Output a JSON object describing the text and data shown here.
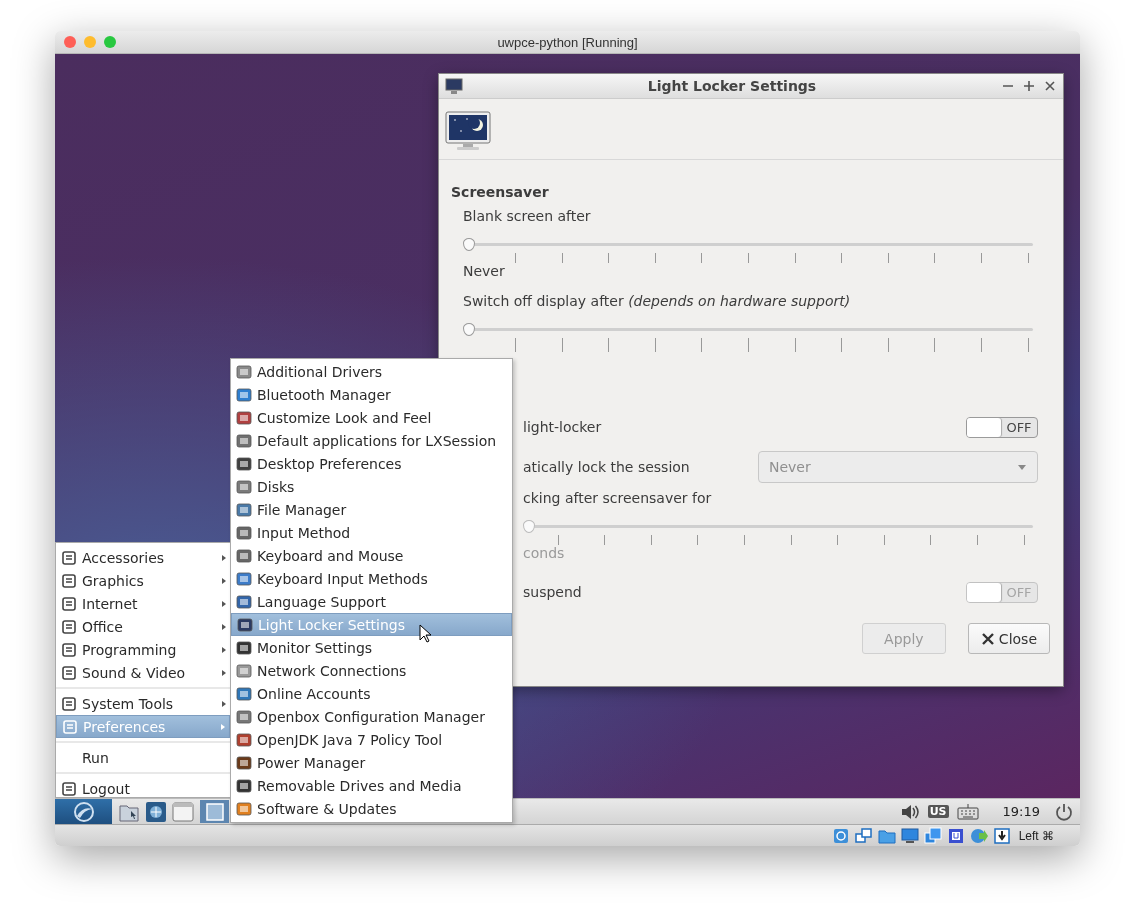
{
  "host_window": {
    "title": "uwpce-python [Running]"
  },
  "dialog": {
    "title": "Light Locker Settings",
    "section": "Screensaver",
    "rows": [
      {
        "kind": "slider",
        "label": "Blank screen after",
        "level": 0,
        "value_label": "Never",
        "disabled": false
      },
      {
        "kind": "slider",
        "label": "Switch off display after *(depends on hardware support)*",
        "level": 0,
        "disabled": false
      }
    ],
    "lock_rows": [
      {
        "kind": "switch",
        "label": "light-locker",
        "on": false,
        "state_text": "OFF",
        "disabled": false
      },
      {
        "kind": "combo",
        "label": "atically lock the session",
        "value": "Never",
        "disabled": true
      },
      {
        "kind": "slider",
        "label": "cking after screensaver for",
        "level": 0,
        "value_label": "conds",
        "disabled": true
      },
      {
        "kind": "switch",
        "label": "suspend",
        "on": false,
        "state_text": "OFF",
        "disabled": true
      }
    ],
    "buttons": [
      {
        "kind": "apply",
        "label": "Apply",
        "disabled": true
      },
      {
        "kind": "close",
        "label": "Close",
        "disabled": false
      }
    ]
  },
  "start_menu": {
    "groups": [
      {
        "items": [
          {
            "label": "Accessories",
            "icon": true,
            "has_submenu": true,
            "selected": false
          },
          {
            "label": "Graphics",
            "icon": true,
            "has_submenu": true,
            "selected": false
          },
          {
            "label": "Internet",
            "icon": true,
            "has_submenu": true,
            "selected": false
          },
          {
            "label": "Office",
            "icon": true,
            "has_submenu": true,
            "selected": false
          },
          {
            "label": "Programming",
            "icon": true,
            "has_submenu": true,
            "selected": false
          },
          {
            "label": "Sound & Video",
            "icon": true,
            "has_submenu": true,
            "selected": false
          }
        ]
      },
      {
        "items": [
          {
            "label": "System Tools",
            "icon": true,
            "has_submenu": true,
            "selected": false
          },
          {
            "label": "Preferences",
            "icon": true,
            "has_submenu": true,
            "selected": true
          }
        ]
      },
      {
        "items": [
          {
            "label": "Run",
            "icon": false,
            "has_submenu": false,
            "selected": false
          }
        ]
      },
      {
        "items": [
          {
            "label": "Logout",
            "icon": true,
            "has_submenu": false,
            "selected": false
          }
        ]
      }
    ]
  },
  "submenu": {
    "items": [
      {
        "label": "Additional Drivers",
        "selected": false
      },
      {
        "label": "Bluetooth Manager",
        "selected": false
      },
      {
        "label": "Customize Look and Feel",
        "selected": false
      },
      {
        "label": "Default applications for LXSession",
        "selected": false
      },
      {
        "label": "Desktop Preferences",
        "selected": false
      },
      {
        "label": "Disks",
        "selected": false
      },
      {
        "label": "File Manager",
        "selected": false
      },
      {
        "label": "Input Method",
        "selected": false
      },
      {
        "label": "Keyboard and Mouse",
        "selected": false
      },
      {
        "label": "Keyboard Input Methods",
        "selected": false
      },
      {
        "label": "Language Support",
        "selected": false
      },
      {
        "label": "Light Locker Settings",
        "selected": true
      },
      {
        "label": "Monitor Settings",
        "selected": false
      },
      {
        "label": "Network Connections",
        "selected": false
      },
      {
        "label": "Online Accounts",
        "selected": false
      },
      {
        "label": "Openbox Configuration Manager",
        "selected": false
      },
      {
        "label": "OpenJDK Java 7 Policy Tool",
        "selected": false
      },
      {
        "label": "Power Manager",
        "selected": false
      },
      {
        "label": "Removable Drives and Media",
        "selected": false
      },
      {
        "label": "Software & Updates",
        "selected": false
      }
    ]
  },
  "panel": {
    "layout": "US",
    "clock": "19:19"
  },
  "vbox_status": {
    "host_key": "Left ⌘"
  }
}
